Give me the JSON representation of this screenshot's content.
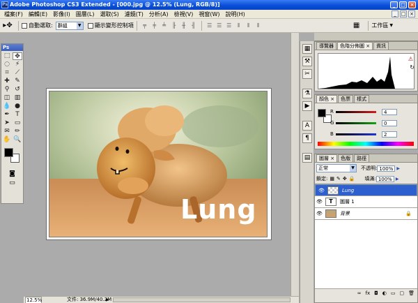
{
  "window": {
    "app_title": "Adobe Photoshop CS3 Extended - [000.jpg @ 12.5% (Lung, RGB/8)]",
    "ps_badge": "Ps",
    "min": "_",
    "max": "□",
    "close": "×"
  },
  "menu": {
    "items": [
      "檔案(F)",
      "編輯(E)",
      "影像(I)",
      "圖層(L)",
      "選取(S)",
      "濾鏡(T)",
      "分析(A)",
      "檢視(V)",
      "視窗(W)",
      "說明(H)"
    ],
    "doc_min": "_",
    "doc_restore": "□",
    "doc_close": "×"
  },
  "options": {
    "auto_select_label": "自動選取:",
    "auto_select_value": "群組",
    "show_transform_label": "顯示變形控制項",
    "workspace_label": "工作區",
    "dropdown_arrow": "▼"
  },
  "toolbox": {
    "header": "Ps"
  },
  "document": {
    "watermark_text": "Lung"
  },
  "status": {
    "zoom": "12.5%",
    "file_info": "文件: 36.9M/40.2M"
  },
  "panels": {
    "navigator_tabs": [
      "導覽器",
      "色階分佈圖",
      "資訊"
    ],
    "color_tabs": [
      "顏色",
      "色票",
      "樣式"
    ],
    "color_rows": [
      {
        "label": "R",
        "value": "4",
        "color": "#d41e1e"
      },
      {
        "label": "G",
        "value": "0",
        "color": "#17a317"
      },
      {
        "label": "B",
        "value": "2",
        "color": "#2234d6"
      }
    ],
    "layers_tabs": [
      "圖層",
      "色版",
      "路徑"
    ],
    "blend_mode": "正常",
    "opacity_label": "不透明:",
    "opacity_value": "100%",
    "lock_label": "鎖定:",
    "fill_label": "填滿:",
    "fill_value": "100%",
    "layers": [
      {
        "name": "Lung",
        "type": "smart",
        "selected": true
      },
      {
        "name": "圖層 1",
        "type": "text",
        "selected": false
      },
      {
        "name": "背景",
        "type": "image",
        "selected": false,
        "locked": true
      }
    ],
    "footer_icons": [
      "link-icon",
      "fx-icon",
      "mask-icon",
      "adjustment-icon",
      "group-icon",
      "new-layer-icon",
      "trash-icon"
    ]
  },
  "colors": {
    "title_blue": "#0a4fd6",
    "selected_layer": "#2e5fcf",
    "foreground": "#000000",
    "background": "#ffffff"
  }
}
